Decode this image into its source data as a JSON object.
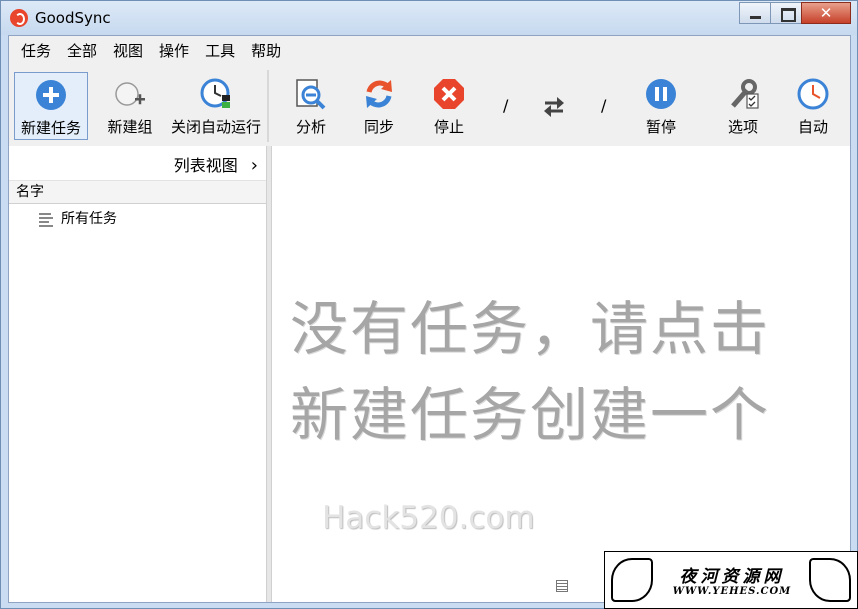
{
  "window": {
    "title": "GoodSync",
    "close_glyph": "✕"
  },
  "menu": [
    "任务",
    "全部",
    "视图",
    "操作",
    "工具",
    "帮助"
  ],
  "toolbar": {
    "left": [
      {
        "label": "新建任务",
        "icon": "plus-circle-icon"
      },
      {
        "label": "新建组",
        "icon": "new-group-icon"
      },
      {
        "label": "关闭自动运行",
        "icon": "auto-clock-icon"
      }
    ],
    "right": [
      {
        "label": "分析",
        "icon": "analyze-icon"
      },
      {
        "label": "同步",
        "icon": "sync-icon"
      },
      {
        "label": "停止",
        "icon": "stop-icon"
      },
      {
        "label": "暂停",
        "icon": "pause-icon"
      },
      {
        "label": "选项",
        "icon": "options-tools-icon"
      },
      {
        "label": "自动",
        "icon": "auto-clock-icon"
      }
    ],
    "separator": "/"
  },
  "left_panel": {
    "view_label": "列表视图",
    "view_chevron": "›",
    "column_header": "名字",
    "items": [
      "所有任务"
    ]
  },
  "right_panel": {
    "empty_message_line1": "没有任务，请点击",
    "empty_message_line2": "新建任务创建一个",
    "watermark": "Hack520.com"
  },
  "badge": {
    "cn": "夜河资源网",
    "en": "WWW.YEHES.COM"
  },
  "colors": {
    "accent_blue": "#3b83d6",
    "sync_orange": "#e8532c",
    "stop_red": "#e8452c",
    "empty_text": "#a6a6a6"
  }
}
